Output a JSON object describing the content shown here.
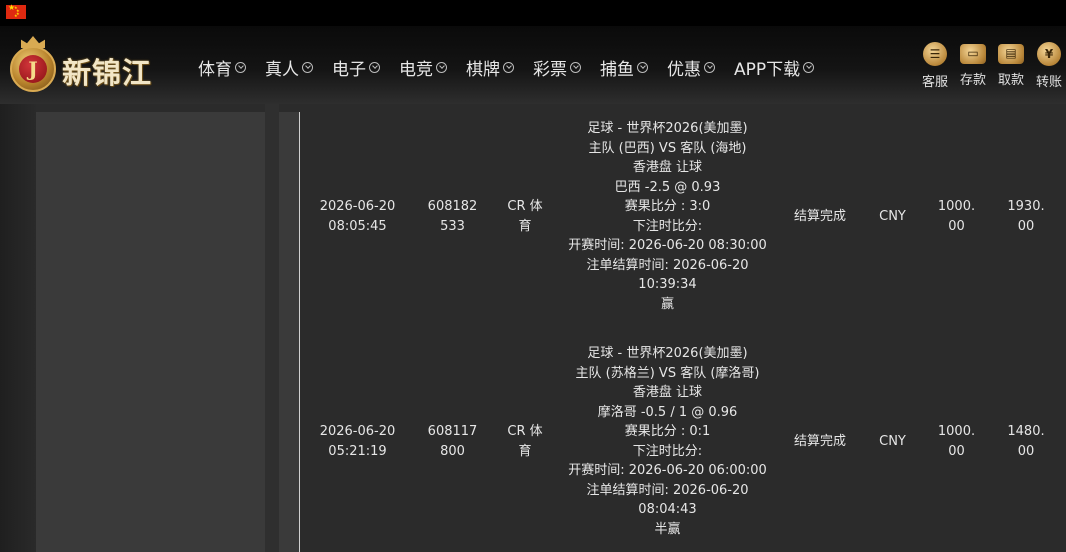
{
  "nav": {
    "items": [
      {
        "label": "体育"
      },
      {
        "label": "真人"
      },
      {
        "label": "电子"
      },
      {
        "label": "电竞"
      },
      {
        "label": "棋牌"
      },
      {
        "label": "彩票"
      },
      {
        "label": "捕鱼"
      },
      {
        "label": "优惠"
      },
      {
        "label": "APP下载"
      }
    ]
  },
  "logo": {
    "initial": "J",
    "text": "新锦江"
  },
  "quick_actions": [
    {
      "label": "客服",
      "icon": "chat-icon"
    },
    {
      "label": "存款",
      "icon": "wallet-icon"
    },
    {
      "label": "取款",
      "icon": "atm-icon"
    },
    {
      "label": "转账",
      "icon": "transfer-coin-icon"
    }
  ],
  "bets": [
    {
      "date": "2026-06-20",
      "time": "08:05:45",
      "bet_id_a": "608182",
      "bet_id_b": "533",
      "platform_a": "CR 体",
      "platform_b": "育",
      "details": [
        "足球 - 世界杯2026(美加墨)",
        "主队 (巴西) VS 客队 (海地)",
        "香港盘 让球",
        "巴西 -2.5 @ 0.93",
        "赛果比分 : 3:0",
        "下注时比分:",
        "开赛时间: 2026-06-20 08:30:00",
        "注单结算时间: 2026-06-20",
        "10:39:34",
        "赢"
      ],
      "status": "结算完成",
      "currency": "CNY",
      "stake_a": "1000.",
      "stake_b": "00",
      "payout_a": "1930.",
      "payout_b": "00"
    },
    {
      "date": "2026-06-20",
      "time": "05:21:19",
      "bet_id_a": "608117",
      "bet_id_b": "800",
      "platform_a": "CR 体",
      "platform_b": "育",
      "details": [
        "足球 - 世界杯2026(美加墨)",
        "主队 (苏格兰) VS 客队 (摩洛哥)",
        "香港盘 让球",
        "摩洛哥 -0.5 / 1 @ 0.96",
        "赛果比分 : 0:1",
        "下注时比分:",
        "开赛时间: 2026-06-20 06:00:00",
        "注单结算时间: 2026-06-20",
        "08:04:43",
        "半赢"
      ],
      "status": "结算完成",
      "currency": "CNY",
      "stake_a": "1000.",
      "stake_b": "00",
      "payout_a": "1480.",
      "payout_b": "00"
    }
  ]
}
